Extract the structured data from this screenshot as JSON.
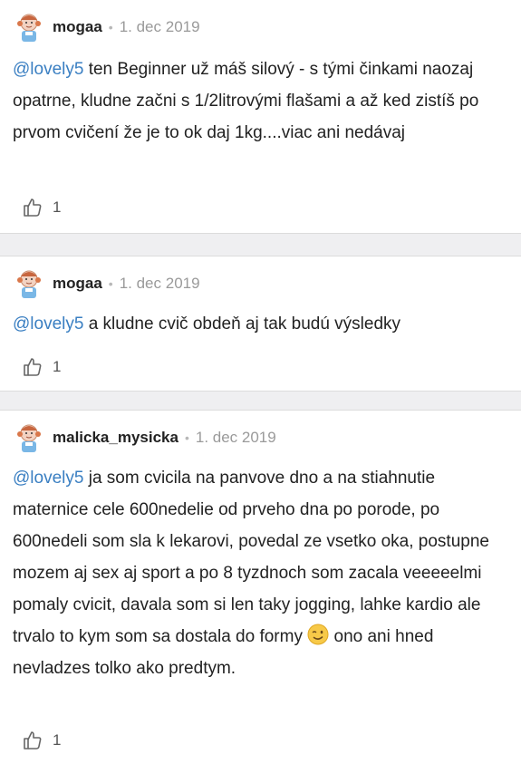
{
  "comments": [
    {
      "username": "mogaa",
      "separator": "•",
      "date": "1. dec 2019",
      "mention": "@lovely5",
      "text": " ten Beginner už máš silový - s tými činkami naozaj opatrne, kludne začni s 1/2litrovými flašami a až ked zistíš po prvom cvičení že je to ok daj 1kg....viac ani nedávaj",
      "likes": "1"
    },
    {
      "username": "mogaa",
      "separator": "•",
      "date": "1. dec 2019",
      "mention": "@lovely5",
      "text": " a kludne cvič obdeň aj tak budú výsledky",
      "likes": "1"
    },
    {
      "username": "malicka_mysicka",
      "separator": "•",
      "date": "1. dec 2019",
      "mention": "@lovely5",
      "text": " ja som cvicila na panvove dno a na stiahnutie maternice cele 600nedelie od prveho dna po porode, po 600nedeli som sla k lekarovi, povedal ze vsetko oka, postupne mozem aj sex aj sport a po 8 tyzdnoch som zacala veeeeelmi pomaly cvicit, davala som si len taky jogging, lahke kardio ale trvalo to kym som sa dostala do formy",
      "text_after_emoji": " ono ani hned nevladzes tolko ako predtym.",
      "emoji": "wink-emoji",
      "likes": "1"
    }
  ]
}
